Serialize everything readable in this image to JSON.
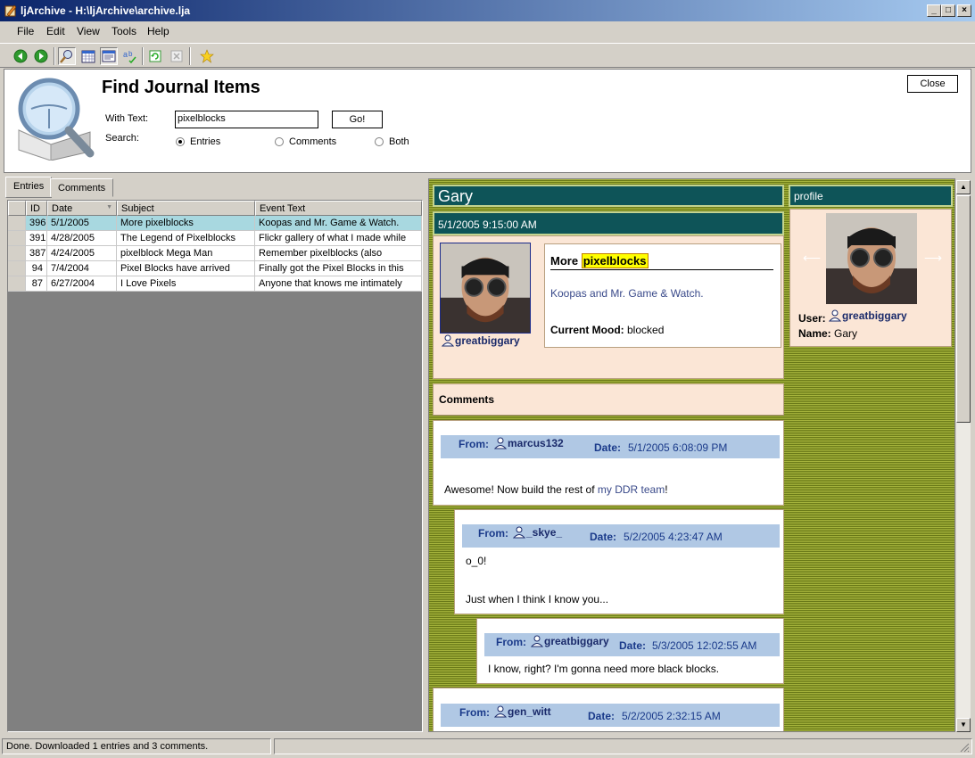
{
  "window": {
    "title": "ljArchive - H:\\ljArchive\\archive.lja"
  },
  "menu": {
    "items": [
      "File",
      "Edit",
      "View",
      "Tools",
      "Help"
    ]
  },
  "find": {
    "heading": "Find Journal Items",
    "with_text_label": "With Text:",
    "with_text_value": "pixelblocks",
    "go_label": "Go!",
    "search_label": "Search:",
    "options": [
      "Entries",
      "Comments",
      "Both"
    ],
    "selected": "Entries",
    "close_label": "Close"
  },
  "results": {
    "tabs": [
      "Entries",
      "Comments"
    ],
    "active_tab": "Entries",
    "columns": [
      "ID",
      "Date",
      "Subject",
      "Event Text"
    ],
    "rows": [
      {
        "id": "396",
        "date": "5/1/2005",
        "subject": "More pixelblocks",
        "text": "Koopas and Mr. Game & Watch."
      },
      {
        "id": "391",
        "date": "4/28/2005",
        "subject": "The Legend of Pixelblocks",
        "text": "Flickr gallery  of what I made while"
      },
      {
        "id": "387",
        "date": "4/24/2005",
        "subject": "pixelblock Mega Man",
        "text": "Remember  pixelblocks  (also"
      },
      {
        "id": "94",
        "date": "7/4/2004",
        "subject": " Pixel Blocks have arrived",
        "text": "Finally got the Pixel Blocks in this"
      },
      {
        "id": "87",
        "date": "6/27/2004",
        "subject": "I Love Pixels",
        "text": "Anyone that knows me  intimately"
      }
    ]
  },
  "entry": {
    "journal_name": "Gary",
    "datetime": "5/1/2005 9:15:00 AM",
    "author": "greatbiggary",
    "subject_prefix": "More",
    "subject_highlight": "pixelblocks",
    "body": "Koopas and Mr. Game & Watch.",
    "mood_label": "Current Mood:",
    "mood_value": "blocked",
    "comments_heading": "Comments"
  },
  "profile": {
    "heading": "profile",
    "user_label": "User:",
    "user_value": "greatbiggary",
    "name_label": "Name:",
    "name_value": "Gary"
  },
  "comments": [
    {
      "from_label": "From:",
      "user": "marcus132",
      "date_label": "Date:",
      "date": "5/1/2005 6:08:09 PM",
      "body_pre": "Awesome! Now build the rest of ",
      "body_link": "my DDR team",
      "body_post": "!"
    },
    {
      "from_label": "From:",
      "user": "_skye_",
      "date_label": "Date:",
      "date": "5/2/2005 4:23:47 AM",
      "line1": "o_0!",
      "line2": "Just when I think I know you..."
    },
    {
      "from_label": "From:",
      "user": "greatbiggary",
      "date_label": "Date:",
      "date": "5/3/2005 12:02:55 AM",
      "body": "I know, right? I'm gonna need more black blocks."
    },
    {
      "from_label": "From:",
      "user": "gen_witt",
      "date_label": "Date:",
      "date": "5/2/2005 2:32:15 AM"
    }
  ],
  "status": {
    "text": "Done.  Downloaded 1 entries and 3 comments."
  },
  "colors": {
    "teal": "#0e5458",
    "peach": "#fbe6d6",
    "comment_header": "#b0c8e4",
    "olive": "#a5b33c",
    "selected_row": "#a8d8e0"
  },
  "icons": [
    "back-icon",
    "forward-icon",
    "search-icon",
    "calendar-icon",
    "browse-icon",
    "spellcheck-icon",
    "refresh-icon",
    "stop-icon",
    "favorite-icon",
    "user-icon"
  ]
}
